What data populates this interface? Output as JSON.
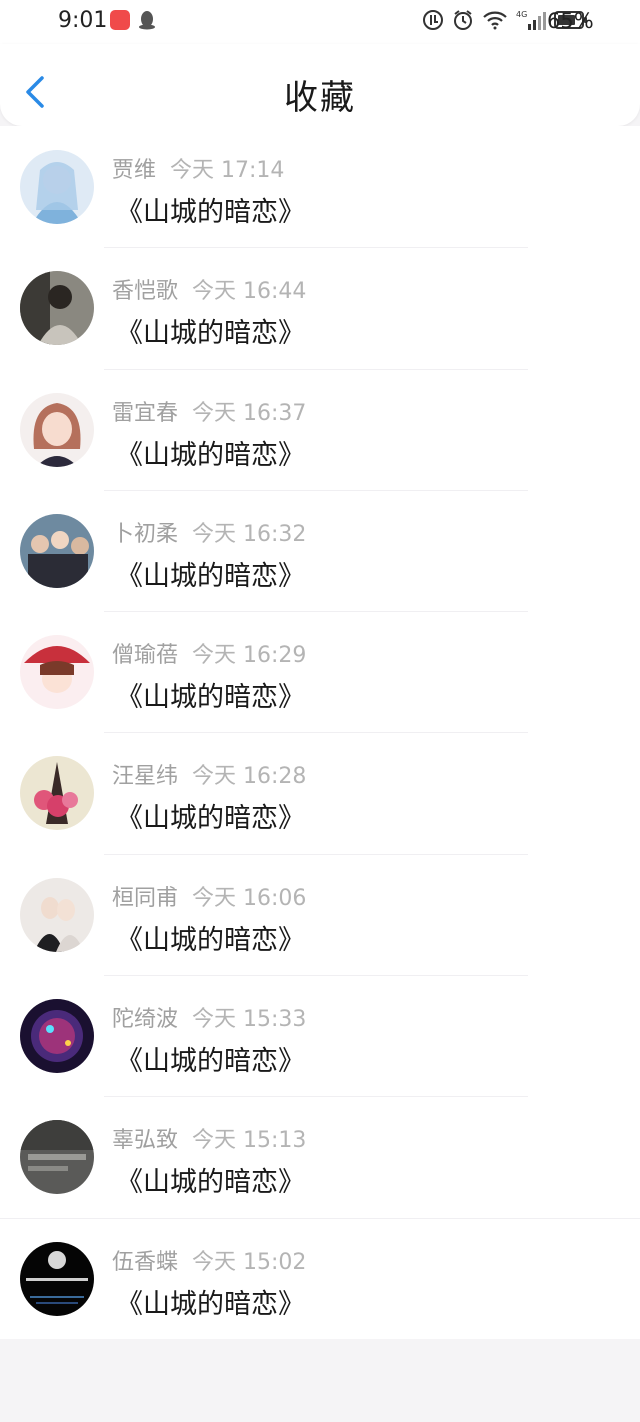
{
  "status_bar": {
    "time": "9:01",
    "network": "4G",
    "battery": "65%"
  },
  "header": {
    "title": "收藏"
  },
  "items": [
    {
      "name": "贾维",
      "time": "今天 17:14",
      "content": "《山城的暗恋》"
    },
    {
      "name": "香恺歌",
      "time": "今天 16:44",
      "content": "《山城的暗恋》"
    },
    {
      "name": "雷宜春",
      "time": "今天 16:37",
      "content": "《山城的暗恋》"
    },
    {
      "name": "卜初柔",
      "time": "今天 16:32",
      "content": "《山城的暗恋》"
    },
    {
      "name": "僧瑜蓓",
      "time": "今天 16:29",
      "content": "《山城的暗恋》"
    },
    {
      "name": "汪星纬",
      "time": "今天 16:28",
      "content": "《山城的暗恋》"
    },
    {
      "name": "桓同甫",
      "time": "今天 16:06",
      "content": "《山城的暗恋》"
    },
    {
      "name": "陀绮波",
      "time": "今天 15:33",
      "content": "《山城的暗恋》"
    },
    {
      "name": "辜弘致",
      "time": "今天 15:13",
      "content": "《山城的暗恋》"
    },
    {
      "name": "伍香蝶",
      "time": "今天 15:02",
      "content": "《山城的暗恋》"
    }
  ]
}
